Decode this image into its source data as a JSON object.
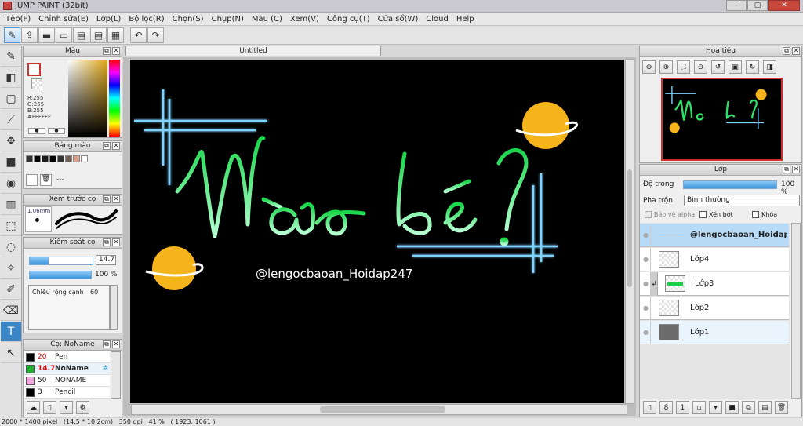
{
  "window": {
    "title": "JUMP PAINT (32bit)",
    "buttons": [
      "–",
      "▢",
      "✕"
    ]
  },
  "menu": [
    "Tệp(F)",
    "Chỉnh sửa(E)",
    "Lớp(L)",
    "Bộ lọc(R)",
    "Chọn(S)",
    "Chụp(N)",
    "Màu (C)",
    "Xem(V)",
    "Công cụ(T)",
    "Cửa sổ(W)",
    "Cloud",
    "Help"
  ],
  "toolbar": {
    "icons": [
      "pen-icon",
      "share-icon",
      "chat-icon",
      "monitor-icon",
      "doc-icon",
      "text-doc-icon",
      "grid-icon",
      "undo-icon",
      "redo-icon"
    ],
    "glyphs": [
      "✎",
      "⇪",
      "▬",
      "▭",
      "▤",
      "▤",
      "▦",
      "↶",
      "↷"
    ]
  },
  "tools": {
    "icons": [
      "brush-icon",
      "eraser-icon",
      "rect-icon",
      "line-icon",
      "move-icon",
      "fill-rect-icon",
      "bucket-icon",
      "gradient-icon",
      "select-rect-icon",
      "lasso-icon",
      "magic-wand-icon",
      "select-pen-icon",
      "select-eraser-icon",
      "text-icon",
      "pointer-icon"
    ],
    "glyphs": [
      "✎",
      "◧",
      "▢",
      "⟋",
      "✥",
      "■",
      "◉",
      "▥",
      "⬚",
      "◌",
      "✧",
      "✐",
      "⌫",
      "T",
      "↖"
    ]
  },
  "color_panel": {
    "title": "Màu",
    "r": "R:255",
    "g": "G:255",
    "b": "B:255",
    "hex": "#FFFFFF",
    "primary": "#ffffff",
    "secondary": "#ffffff"
  },
  "palette_panel": {
    "title": "Bảng màu",
    "label": "---",
    "swatches": [
      "#333333",
      "#000000",
      "#1a1a1a",
      "#000000",
      "#333333",
      "#6e5e56",
      "#dba08e",
      "#ffffff"
    ]
  },
  "preview_panel": {
    "title": "Xem trước cọ",
    "size": "1.06mm"
  },
  "control_panel": {
    "title": "Kiểm soát cọ",
    "size": "14.7",
    "opacity": "100 %",
    "opacity_value": 1.0,
    "size_fraction": 0.3,
    "edge_label": "Chiều rộng cạnh",
    "edge_value": "60"
  },
  "brush_panel": {
    "title": "Cọ: NoName",
    "items": [
      {
        "size": "20",
        "name": "Pen",
        "color": "#000000"
      },
      {
        "size": "14.7",
        "name": "NoName",
        "color": "#22aa33"
      },
      {
        "size": "50",
        "name": "NONAME",
        "color": "#f5a6e0"
      },
      {
        "size": "3",
        "name": "Pencil",
        "color": "#000000"
      }
    ]
  },
  "document": {
    "tab": "Untitled",
    "line1": "Nào bé ?",
    "watermark": "@lengocbaoan_Hoidap247"
  },
  "navigator": {
    "title": "Hoa tiêu"
  },
  "layers_panel": {
    "title": "Lớp",
    "opacity_label": "Độ trong",
    "opacity": "100 %",
    "opacity_value": 1.0,
    "blend_label": "Pha trộn",
    "blend_value": "Bình thường",
    "protect_alpha": "Bảo vệ alpha",
    "clip": "Xén bớt",
    "lock": "Khóa",
    "layers": [
      {
        "name": "@lengocbaoan_Hoidap247"
      },
      {
        "name": "Lớp4"
      },
      {
        "name": "Lớp3"
      },
      {
        "name": "Lớp2"
      },
      {
        "name": "Lớp1"
      }
    ]
  },
  "status": "2000 * 1400 pixel   (14.5 * 10.2cm)   350 dpi   41 %   ( 1923, 1061 )"
}
